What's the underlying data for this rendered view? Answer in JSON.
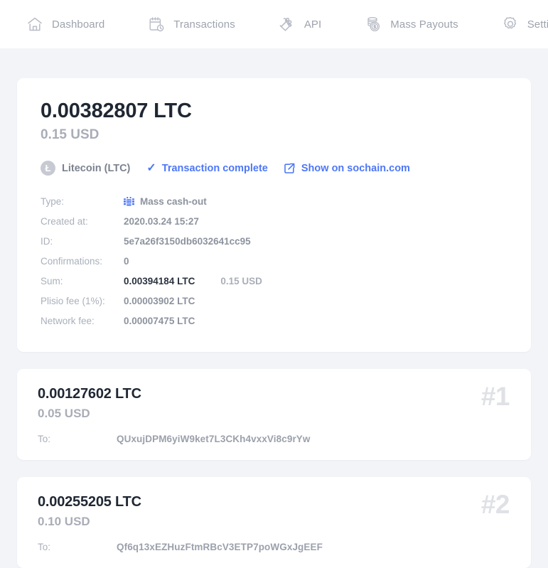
{
  "nav": {
    "items": [
      {
        "label": "Dashboard",
        "icon": "home-icon"
      },
      {
        "label": "Transactions",
        "icon": "calendar-clock-icon"
      },
      {
        "label": "API",
        "icon": "puzzle-piece-icon"
      },
      {
        "label": "Mass Payouts",
        "icon": "coins-icon"
      },
      {
        "label": "Settings",
        "icon": "gear-icon"
      }
    ]
  },
  "transaction": {
    "amount_crypto": "0.00382807 LTC",
    "amount_fiat": "0.15 USD",
    "coin_symbol": "Ł",
    "coin_name": "Litecoin (LTC)",
    "status": "Transaction complete",
    "status_icon": "check-icon",
    "explorer_link": "Show on sochain.com",
    "explorer_icon": "external-link-icon",
    "accent_color": "#4d77f7",
    "details": [
      {
        "label": "Type:",
        "value": "Mass cash-out",
        "icon": "mass-cashout-icon"
      },
      {
        "label": "Created at:",
        "value": "2020.03.24 15:27"
      },
      {
        "label": "ID:",
        "value": "5e7a26f3150db6032641cc95"
      },
      {
        "label": "Confirmations:",
        "value": "0"
      },
      {
        "label": "Sum:",
        "value": "0.00394184 LTC",
        "value_strong": true,
        "second_value": "0.15 USD"
      },
      {
        "label": "Plisio fee (1%):",
        "value": "0.00003902 LTC"
      },
      {
        "label": "Network fee:",
        "value": "0.00007475 LTC"
      }
    ]
  },
  "payouts": [
    {
      "rank": "#1",
      "amount_crypto": "0.00127602 LTC",
      "amount_fiat": "0.05 USD",
      "to_label": "To:",
      "to_address": "QUxujDPM6yiW9ket7L3CKh4vxxVi8c9rYw"
    },
    {
      "rank": "#2",
      "amount_crypto": "0.00255205 LTC",
      "amount_fiat": "0.10 USD",
      "to_label": "To:",
      "to_address": "Qf6q13xEZHuzFtmRBcV3ETP7poWGxJgEEF"
    }
  ]
}
